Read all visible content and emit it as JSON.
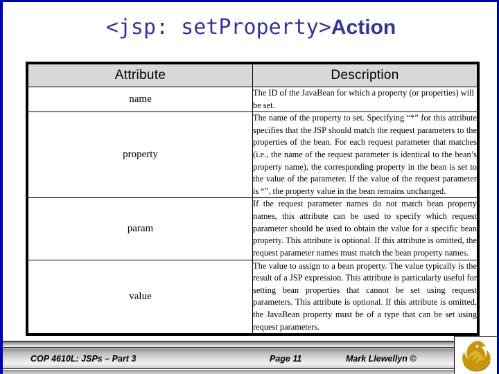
{
  "slide": {
    "title_code": "<jsp: setProperty>",
    "title_word": "Action",
    "accent_color": "#333399",
    "border_color": "#0000b4"
  },
  "table": {
    "headers": [
      "Attribute",
      "Description"
    ],
    "header_bg": "#d8d8d8",
    "rows": [
      {
        "attribute": "name",
        "description": "The ID of the JavaBean for which a property (or properties) will be set."
      },
      {
        "attribute": "property",
        "description": "The name of the property to set.  Specifying “*” for this attribute specifies that the JSP should match the request parameters to the properties of the bean.  For each request parameter that matches (i.e., the name of the request parameter is identical to the bean’s property name), the corresponding property in the bean is set to the value of the parameter.  If the value of the request parameter is “”, the property value in the bean remains unchanged."
      },
      {
        "attribute": "param",
        "description": "If the request parameter names do not match bean property names, this attribute can be used to specify which request parameter should be used to obtain the value for a specific bean property.  This attribute is optional.  If this attribute is omitted, the request parameter names must match the bean property names."
      },
      {
        "attribute": "value",
        "description": "The value to assign to a bean property.  The value typically is the result of a JSP expression.  This attribute is particularly useful for setting bean properties that cannot be set using request parameters.  This attribute is optional.  If this attribute is omitted, the JavaBean property must be of a type that can be set using request parameters."
      }
    ]
  },
  "footer": {
    "course": "COP 4610L: JSPs – Part 3",
    "page": "Page 11",
    "author": "Mark Llewellyn ©",
    "logo_name": "ucf-pegasus-logo",
    "logo_color": "#c8960c"
  }
}
